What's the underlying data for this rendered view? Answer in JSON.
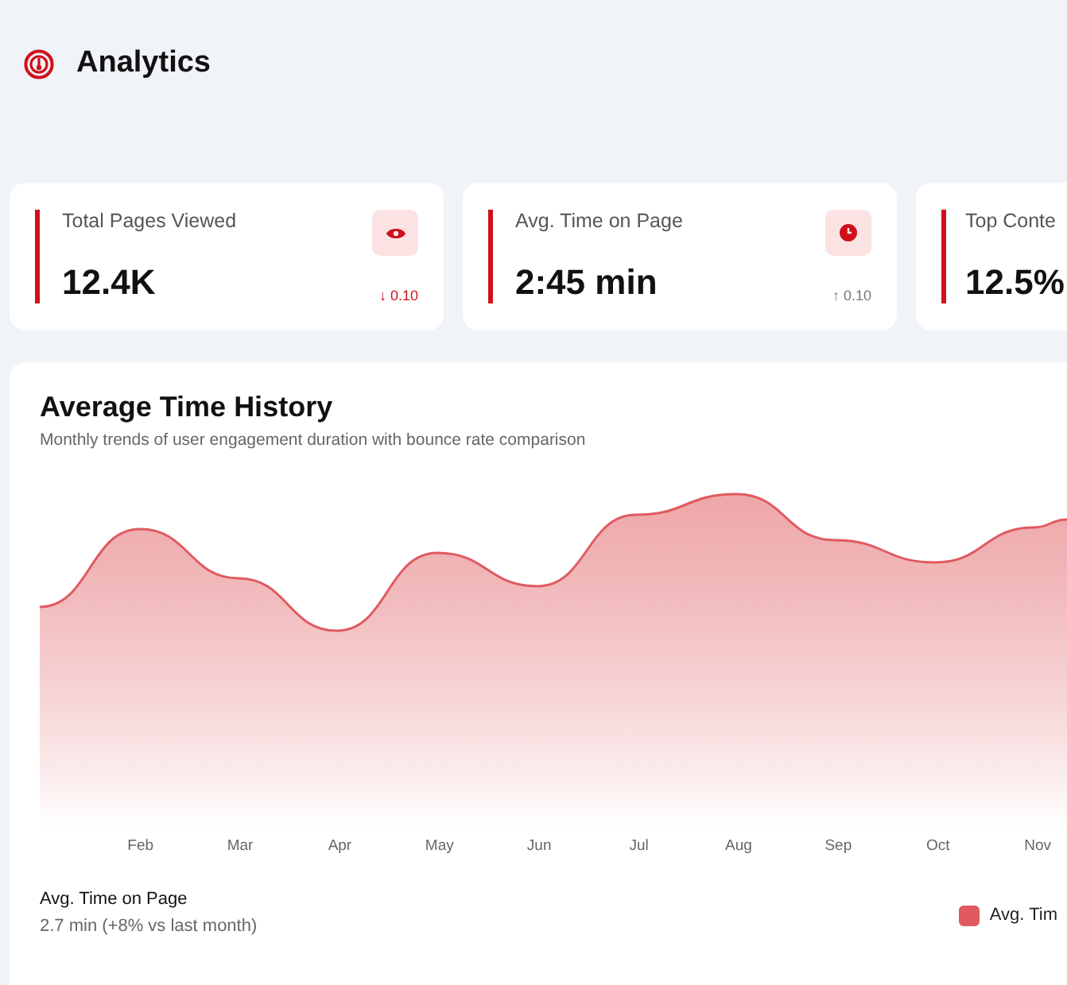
{
  "header": {
    "title": "Analytics"
  },
  "stats": [
    {
      "label": "Total Pages Viewed",
      "value": "12.4K",
      "change": "↓ 0.10",
      "color": "#d0101a"
    },
    {
      "label": "Avg. Time on Page",
      "value": "2:45 min",
      "change": "↑ 0.10",
      "color": "#777777"
    },
    {
      "label": "Top Conte",
      "value": "12.5%"
    }
  ],
  "chart_card": {
    "title": "Average Time History",
    "subtitle": "Monthly trends of user engagement duration with bounce rate comparison",
    "months": [
      "Feb",
      "Mar",
      "Apr",
      "May",
      "Jun",
      "Jul",
      "Aug",
      "Sep",
      "Oct",
      "Nov"
    ],
    "summary_label": "Avg. Time on Page",
    "summary_value": "2.7 min (+8% vs last month)",
    "legend": [
      {
        "label": "Avg. Tim",
        "color": "#e05a5f"
      }
    ]
  }
}
